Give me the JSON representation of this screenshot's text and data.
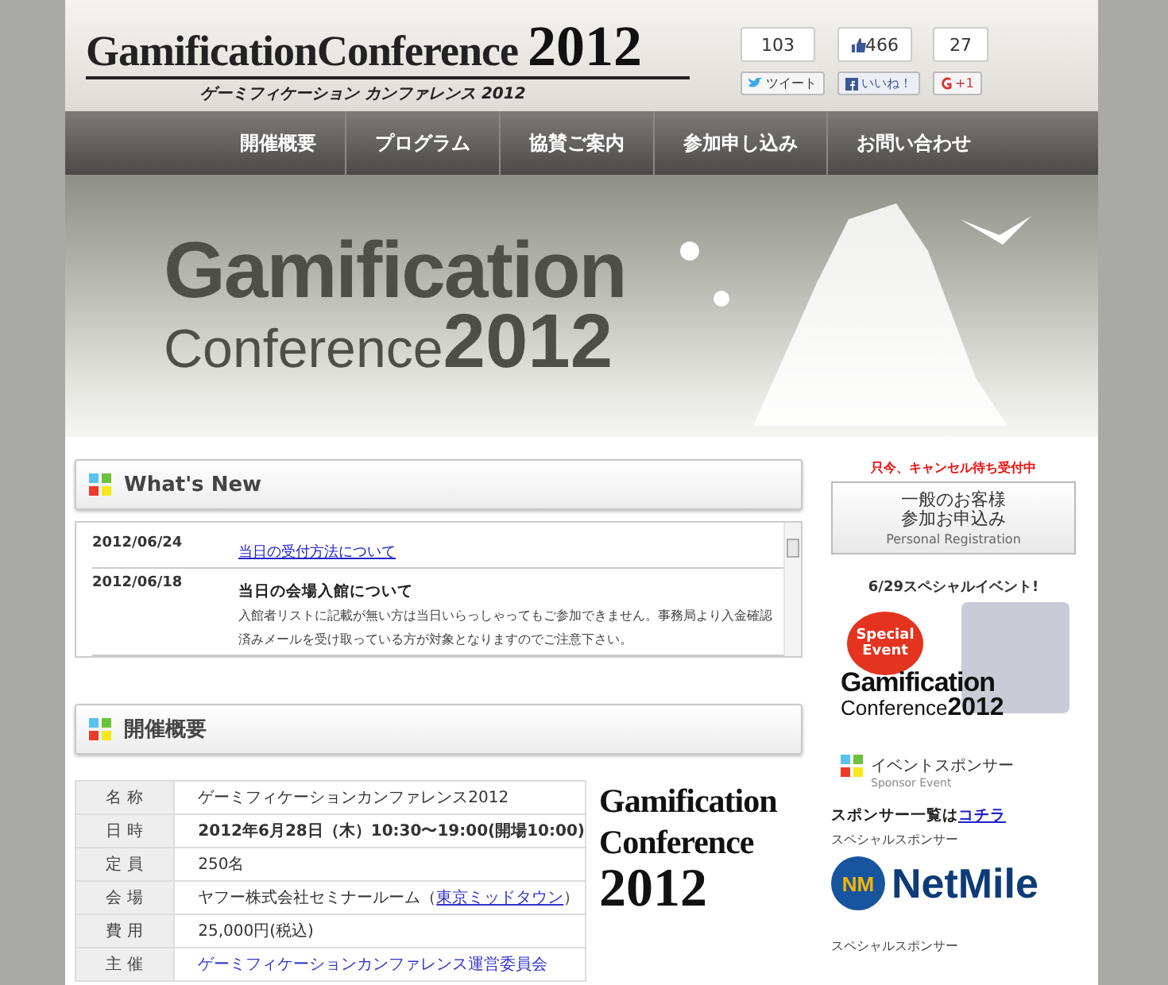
{
  "header": {
    "logo": {
      "title": "GamificationConference",
      "year": "2012",
      "subtitle": "ゲーミフィケーション カンファレンス 2012"
    },
    "social": [
      {
        "kind": "twitter",
        "count": "103",
        "label": "ツイート"
      },
      {
        "kind": "facebook",
        "count": "466",
        "label": "いいね！"
      },
      {
        "kind": "google",
        "count": "27",
        "label": "+1"
      }
    ]
  },
  "nav": [
    "開催概要",
    "プログラム",
    "協賛ご案内",
    "参加申し込み",
    "お問い合わせ"
  ],
  "hero": {
    "line1": "Gamification",
    "line2": "Conference",
    "year": "2012"
  },
  "whats_new": {
    "title": "What's New",
    "items": [
      {
        "kind": "link",
        "date": "2012/06/24",
        "title": "当日の受付方法について"
      },
      {
        "kind": "notice",
        "date": "2012/06/18",
        "title": "当日の会場入館について",
        "body": "入館者リストに記載が無い方は当日いらっしゃってもご参加できません。事務局より入金確認済みメールを受け取っている方が対象となりますのでご注意下さい。"
      }
    ]
  },
  "overview": {
    "title": "開催概要",
    "rows": [
      {
        "kind": "text",
        "label": "名 称",
        "value": "ゲーミフィケーションカンファレンス2012"
      },
      {
        "kind": "bold",
        "label": "日 時",
        "value": "2012年6月28日（木）10:30〜19:00(開場10:00)"
      },
      {
        "kind": "text",
        "label": "定 員",
        "value": "250名"
      },
      {
        "kind": "venue",
        "label": "会 場",
        "value": "ヤフー株式会社セミナールーム（",
        "link": "東京ミッドタウン",
        "after": "）"
      },
      {
        "kind": "text",
        "label": "費 用",
        "value": "25,000円(税込)"
      },
      {
        "kind": "link",
        "label": "主 催",
        "value": "ゲーミフィケーションカンファレンス運営委員会"
      }
    ],
    "logo": {
      "line1": "Gamification",
      "line2": "Conference",
      "year": "2012"
    }
  },
  "sidebar": {
    "notice": "只今、キャンセル待ち受付中",
    "registration": {
      "line1": "一般のお客様",
      "line2": "参加お申込み",
      "caption": "Personal Registration"
    },
    "event_title": "6/29スペシャルイベント!",
    "banner": {
      "badge1": "Special",
      "badge2": "Event",
      "line1": "Gamification",
      "line2": "Conference",
      "year": "2012"
    },
    "sponsor_heading": {
      "title": "イベントスポンサー",
      "caption": "Sponsor Event"
    },
    "sponsor_list": {
      "text": "スポンサー一覧は",
      "link": "コチラ"
    },
    "sponsors": [
      {
        "label": "スペシャルスポンサー",
        "mark": "NM",
        "name": "NetMile"
      },
      {
        "label": "スペシャルスポンサー"
      }
    ]
  }
}
